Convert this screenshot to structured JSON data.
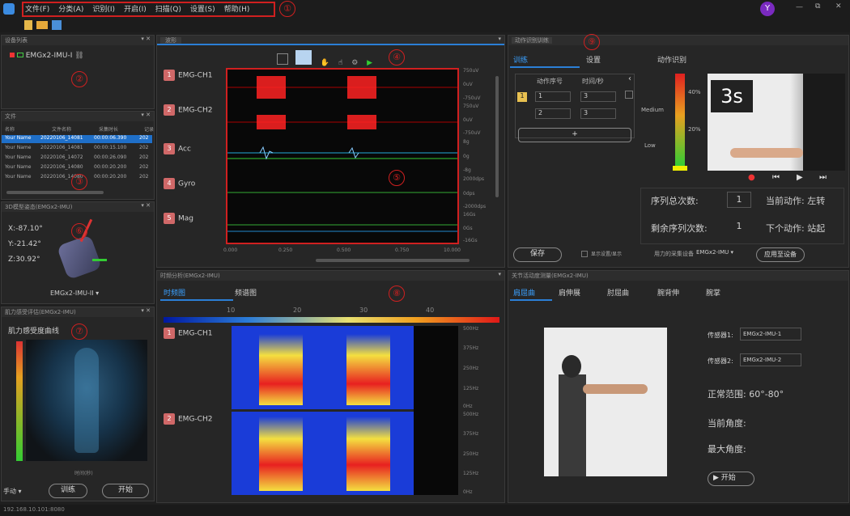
{
  "menu": [
    "文件(F)",
    "分类(A)",
    "识别(I)",
    "开启(I)",
    "扫描(Q)",
    "设置(S)",
    "帮助(H)"
  ],
  "user_initial": "Y",
  "window_controls": [
    "—",
    "⧉",
    "✕"
  ],
  "markers": [
    "①",
    "②",
    "③",
    "④",
    "⑤",
    "⑥",
    "⑦",
    "⑧",
    "⑨"
  ],
  "panels": {
    "device": {
      "title": "设备列表",
      "device_name": "EMGx2-IMU-I"
    },
    "list": {
      "title": "文件",
      "headers": [
        "名称",
        "文件名称",
        "采集时长",
        "记录"
      ],
      "rows": [
        [
          "Your Name",
          "20220106_14081",
          "00:00:06.390",
          "202"
        ],
        [
          "Your Name",
          "20220106_14081",
          "00:00:15.100",
          "202"
        ],
        [
          "Your Name",
          "20220106_14072",
          "00:00:26.090",
          "202"
        ],
        [
          "Your Name",
          "20220106_14080",
          "00:00:20.200",
          "202"
        ],
        [
          "Your Name",
          "20220106_14080",
          "00:00:20.200",
          "202"
        ]
      ]
    },
    "model3d": {
      "title": "3D模型姿态(EMGx2-IMU)",
      "x": "X:-87.10°",
      "y": "Y:-21.42°",
      "z": "Z:30.92°",
      "device": "EMGx2-IMU-II"
    },
    "muscle": {
      "title": "肌力感受评估(EMGx2-IMU)",
      "subtitle": "肌力感受度曲线",
      "x_label": "时间(秒)",
      "mode": "手动",
      "btn_train": "训练",
      "btn_start": "开始"
    },
    "wave": {
      "tab": "波形",
      "channels": [
        "EMG-CH1",
        "EMG-CH2",
        "Acc",
        "Gyro",
        "Mag"
      ],
      "yticks": [
        "750uV",
        "0uV",
        "-750uV",
        "750uV",
        "0uV",
        "-750uV",
        "8g",
        "0g",
        "-8g",
        "2000dps",
        "0dps",
        "-2000dps",
        "16Gs",
        "0Gs",
        "-16Gs"
      ],
      "xticks": [
        "0.000",
        "0.250",
        "0.500",
        "0.750",
        "10.000"
      ]
    },
    "action": {
      "title": "动作识别训练",
      "tabs": [
        "训练",
        "设置",
        "动作识别"
      ],
      "col_headers": [
        "动作序号",
        "时间/秒"
      ],
      "row1": [
        "1",
        "1",
        "3"
      ],
      "row2": [
        "2",
        "3"
      ],
      "add": "+",
      "gauge_labels": [
        "Medium",
        "Low"
      ],
      "pct": [
        "40%",
        "20%"
      ],
      "countdown": "3s",
      "total_label": "序列总次数:",
      "total_val": "1",
      "remain_label": "剩余序列次数:",
      "remain_val": "1",
      "cur_action": "当前动作: 左转",
      "next_action": "下个动作: 站起",
      "save": "保存",
      "check_label": "显示设置/显示",
      "device_label": "用力的采集设备",
      "device_val": "EMGx2-IMU",
      "apply": "应用至设备"
    },
    "spectrum": {
      "title": "时频分析(EMGx2-IMU)",
      "tabs": [
        "时频图",
        "频谱图"
      ],
      "scale": [
        "10",
        "20",
        "30",
        "40"
      ],
      "channels": [
        "EMG-CH1",
        "EMG-CH2"
      ],
      "yticks": [
        "500Hz",
        "375Hz",
        "250Hz",
        "125Hz",
        "0Hz",
        "500Hz",
        "375Hz",
        "250Hz",
        "125Hz",
        "0Hz"
      ]
    },
    "rom": {
      "title": "关节活动度测量(EMGx2-IMU)",
      "tabs": [
        "肩屈曲",
        "肩伸展",
        "肘屈曲",
        "腕背伸",
        "腕掌"
      ],
      "sensor1_label": "传感器1:",
      "sensor1_val": "EMGx2-IMU-1",
      "sensor2_label": "传感器2:",
      "sensor2_val": "EMGx2-IMU-2",
      "normal_range": "正常范围: 60°-80°",
      "current_angle": "当前角度:",
      "max_angle": "最大角度:",
      "start": "▶ 开始"
    }
  },
  "status": "192.168.10.101:8080"
}
